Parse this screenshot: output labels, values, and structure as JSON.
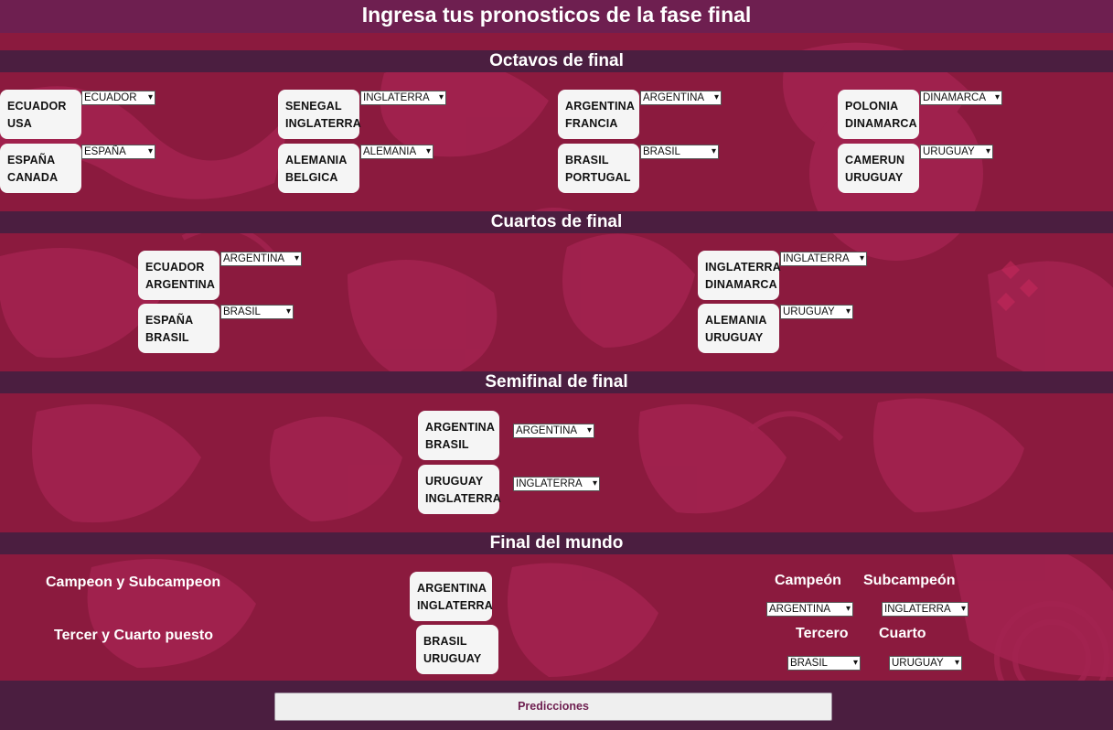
{
  "page_title": "Ingresa tus pronosticos de la fase final",
  "sections": {
    "octavos": "Octavos de final",
    "cuartos": "Cuartos de final",
    "semifinal": "Semifinal de final",
    "final": "Final del mundo"
  },
  "octavos": [
    {
      "team1": "ECUADOR",
      "team2": "USA",
      "pick": "ECUADOR"
    },
    {
      "team1": "ESPAÑA",
      "team2": "CANADA",
      "pick": "ESPAÑA"
    },
    {
      "team1": "SENEGAL",
      "team2": "INGLATERRA",
      "pick": "INGLATERRA"
    },
    {
      "team1": "ALEMANIA",
      "team2": "BELGICA",
      "pick": "ALEMANIA"
    },
    {
      "team1": "ARGENTINA",
      "team2": "FRANCIA",
      "pick": "ARGENTINA"
    },
    {
      "team1": "BRASIL",
      "team2": "PORTUGAL",
      "pick": "BRASIL"
    },
    {
      "team1": "POLONIA",
      "team2": "DINAMARCA",
      "pick": "DINAMARCA"
    },
    {
      "team1": "CAMERUN",
      "team2": "URUGUAY",
      "pick": "URUGUAY"
    }
  ],
  "cuartos": [
    {
      "team1": "ECUADOR",
      "team2": "ARGENTINA",
      "pick": "ARGENTINA"
    },
    {
      "team1": "ESPAÑA",
      "team2": "BRASIL",
      "pick": "BRASIL"
    },
    {
      "team1": "INGLATERRA",
      "team2": "DINAMARCA",
      "pick": "INGLATERRA"
    },
    {
      "team1": "ALEMANIA",
      "team2": "URUGUAY",
      "pick": "URUGUAY"
    }
  ],
  "semifinal": [
    {
      "team1": "ARGENTINA",
      "team2": "BRASIL",
      "pick": "ARGENTINA"
    },
    {
      "team1": "URUGUAY",
      "team2": "INGLATERRA",
      "pick": "INGLATERRA"
    }
  ],
  "final": {
    "campeon_subcampeon_label": "Campeon y Subcampeon",
    "tercer_cuarto_label": "Tercer y Cuarto puesto",
    "final_match": {
      "team1": "ARGENTINA",
      "team2": "INGLATERRA"
    },
    "third_match": {
      "team1": "BRASIL",
      "team2": "URUGUAY"
    },
    "campeon_label": "Campeón",
    "subcampeon_label": "Subcampeón",
    "tercero_label": "Tercero",
    "cuarto_label": "Cuarto",
    "campeon_pick": "ARGENTINA",
    "subcampeon_pick": "INGLATERRA",
    "tercero_pick": "BRASIL",
    "cuarto_pick": "URUGUAY"
  },
  "submit_label": "Predicciones",
  "colors": {
    "background": "#8b1a3e",
    "title_bar": "#6e1f50",
    "section_band": "#4b1e40",
    "card": "#f5f5f5"
  }
}
